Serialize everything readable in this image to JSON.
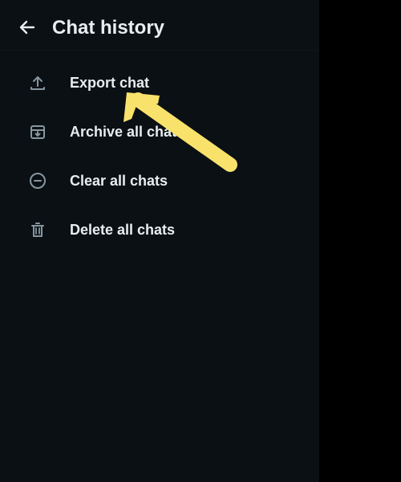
{
  "header": {
    "back_icon": "arrow-left-icon",
    "title": "Chat history"
  },
  "menu": {
    "items": [
      {
        "icon": "upload-icon",
        "label": "Export chat"
      },
      {
        "icon": "archive-icon",
        "label": "Archive all chats"
      },
      {
        "icon": "minus-circle-icon",
        "label": "Clear all chats"
      },
      {
        "icon": "trash-icon",
        "label": "Delete all chats"
      }
    ]
  },
  "annotation": {
    "arrow_color": "#f8e26b",
    "arrow_icon": "pointer-arrow-icon"
  },
  "colors": {
    "background": "#0b1014",
    "outer_background": "#000000",
    "text_primary": "#e9edef",
    "icon_muted": "#8696a0"
  }
}
